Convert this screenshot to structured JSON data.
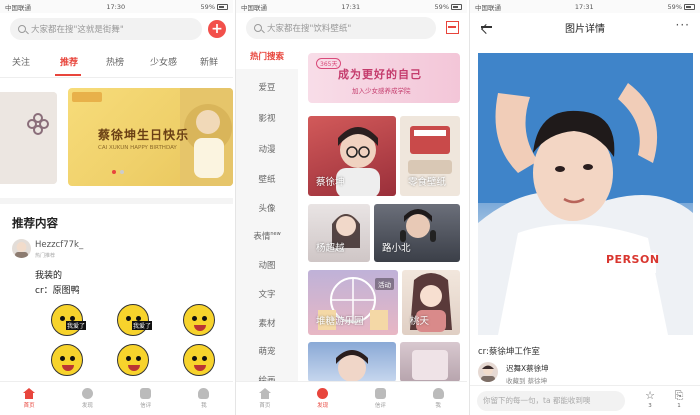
{
  "panel1": {
    "status": {
      "carrier": "中国联通",
      "time": "17:30",
      "battery": "59%"
    },
    "search_placeholder": "大家都在搜\"这就是街舞\"",
    "add_label": "+",
    "tabs": [
      "关注",
      "推荐",
      "热榜",
      "少女感",
      "新鲜"
    ],
    "active_tab": "推荐",
    "banner_title": "蔡徐坤生日快乐",
    "banner_subtitle": "CAI XUKUN HAPPY BIRTHDAY",
    "section_title": "推荐内容",
    "post": {
      "user": "Hezzcf77k_",
      "badge": "热门推荐",
      "line1": "我装的",
      "line2": "cr：原图鸭"
    },
    "stickers": [
      "我爱了",
      "我爱了",
      "",
      "",
      "",
      ""
    ],
    "nav": [
      "首页",
      "发现",
      "信评",
      "我"
    ],
    "nav_active": "首页"
  },
  "panel2": {
    "status": {
      "carrier": "中国联通",
      "time": "17:31",
      "battery": "59%"
    },
    "search_placeholder": "大家都在搜\"饮料壁纸\"",
    "categories": [
      "热门搜索",
      "爱豆",
      "影视",
      "动漫",
      "壁纸",
      "头像",
      "表情",
      "动图",
      "文字",
      "素材",
      "萌宠",
      "绘画"
    ],
    "category_new_tag": "new",
    "promo": {
      "tag": "365天",
      "title": "成为更好的自己",
      "subtitle": "加入少女感养成学院"
    },
    "tiles": [
      {
        "label": "蔡徐坤",
        "badge": ""
      },
      {
        "label": "零食壁纸",
        "badge": ""
      },
      {
        "label": "杨超越",
        "badge": ""
      },
      {
        "label": "路小北",
        "badge": ""
      },
      {
        "label": "堆糖游乐园",
        "badge": "活动"
      },
      {
        "label": "桃夭",
        "badge": ""
      }
    ],
    "nav": [
      "首页",
      "发现",
      "信评",
      "我"
    ],
    "nav_active": "发现"
  },
  "panel3": {
    "status": {
      "carrier": "中国联通",
      "time": "17:31",
      "battery": "59%"
    },
    "title": "图片详情",
    "more": "···",
    "caption": "cr:蔡徐坤工作室",
    "author_name": "迟舞X蔡徐坤",
    "author_sub": "收藏到 蔡徐坤",
    "comment_placeholder": "你留下的每一句，ta 都能收到噢",
    "favorite_count": "3",
    "share_count": "1",
    "shirt_text": "PERSON"
  },
  "colors": {
    "accent": "#e8453c",
    "photo_bg": "#3f84c9"
  }
}
